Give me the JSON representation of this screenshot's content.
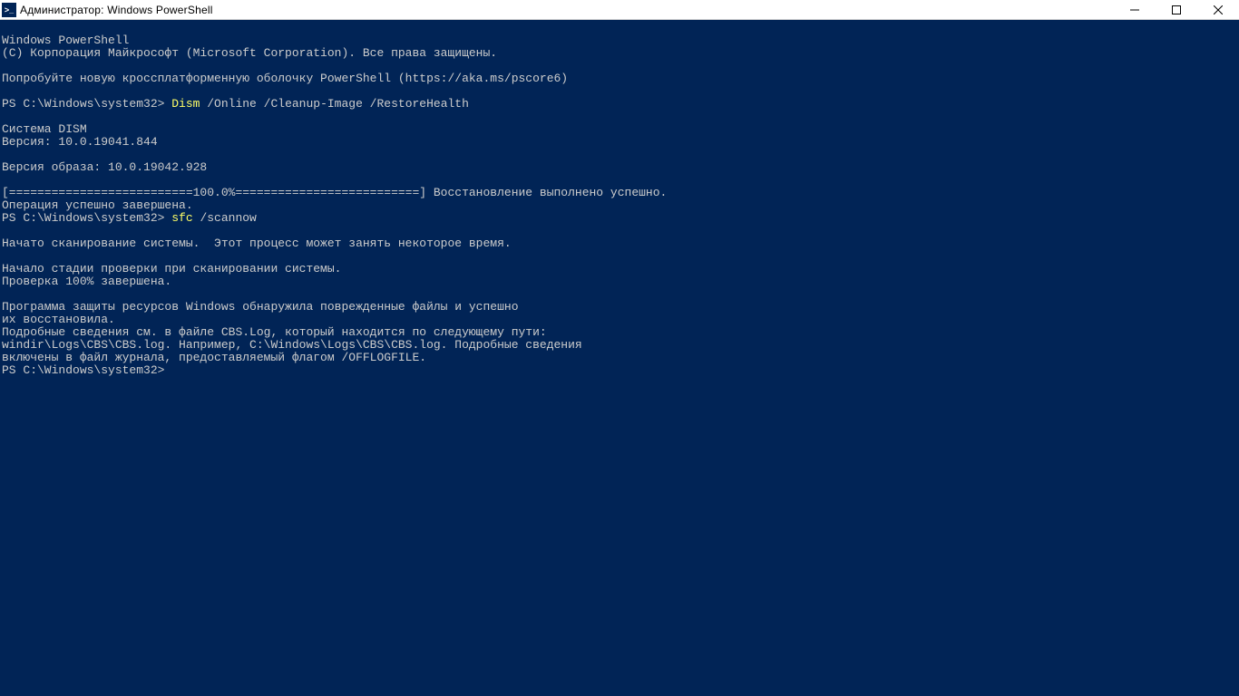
{
  "window": {
    "title": "Администратор: Windows PowerShell"
  },
  "terminal": {
    "header_line": "Windows PowerShell",
    "copyright_line": "(C) Корпорация Майкрософт (Microsoft Corporation). Все права защищены.",
    "try_line": "Попробуйте новую кроссплатформенную оболочку PowerShell (https://aka.ms/pscore6)",
    "prompt1_prefix": "PS C:\\Windows\\system32> ",
    "cmd1_yellow": "Dism",
    "cmd1_rest": " /Online /Cleanup-Image /RestoreHealth",
    "dism_title": "Cистема DISM",
    "dism_version": "Версия: 10.0.19041.844",
    "image_version": "Версия образа: 10.0.19042.928",
    "progress_line": "[==========================100.0%==========================] Восстановление выполнено успешно.",
    "operation_done": "Операция успешно завершена.",
    "prompt2_prefix": "PS C:\\Windows\\system32> ",
    "cmd2_yellow": "sfc",
    "cmd2_rest": " /scannow",
    "scan_started": "Начато сканирование системы.  Этот процесс может занять некоторое время.",
    "verify_stage": "Начало стадии проверки при сканировании системы.",
    "verify_done": "Проверка 100% завершена.",
    "sfc_result1": "Программа защиты ресурсов Windows обнаружила поврежденные файлы и успешно",
    "sfc_result2": "их восстановила.",
    "sfc_details1": "Подробные сведения см. в файле CBS.Log, который находится по следующему пути:",
    "sfc_details2": "windir\\Logs\\CBS\\CBS.log. Например, C:\\Windows\\Logs\\CBS\\CBS.log. Подробные сведения",
    "sfc_details3": "включены в файл журнала, предоставляемый флагом /OFFLOGFILE.",
    "prompt3": "PS C:\\Windows\\system32>"
  }
}
